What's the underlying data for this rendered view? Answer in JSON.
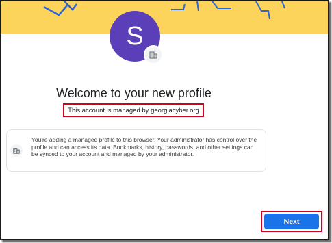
{
  "profile": {
    "avatar_initial": "S",
    "avatar_color": "#5b3fb8",
    "badge_icon": "building-icon"
  },
  "header": {
    "title": "Welcome to your new profile",
    "managed_by": "This account is managed by georgiacyber.org"
  },
  "info_card": {
    "icon": "building-icon",
    "text": "You're adding a managed profile to this browser. Your administrator has control over the profile and can access its data. Bookmarks, history, passwords, and other settings can be synced to your account and managed by your administrator."
  },
  "footer": {
    "next_label": "Next",
    "accent_color": "#1a73e8"
  },
  "banner": {
    "color": "#fcd45c"
  }
}
